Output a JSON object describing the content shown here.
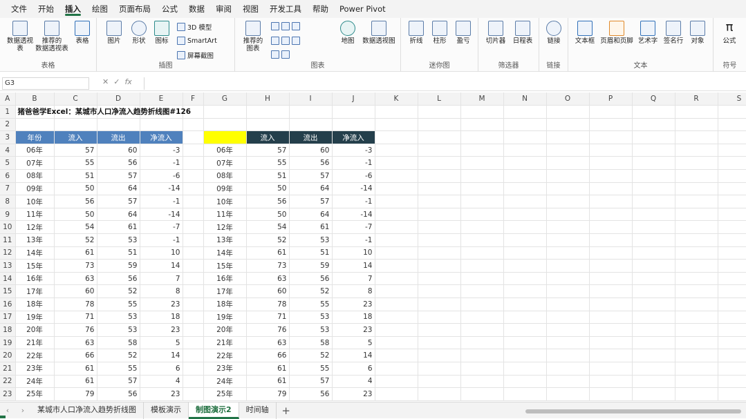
{
  "menu": [
    "文件",
    "开始",
    "插入",
    "绘图",
    "页面布局",
    "公式",
    "数据",
    "审阅",
    "视图",
    "开发工具",
    "帮助",
    "Power Pivot"
  ],
  "menu_active_index": 2,
  "ribbon": {
    "tables": {
      "title": "表格",
      "b1": "数据透视表",
      "b1b": "视表",
      "b2": "推荐的",
      "b2b": "数据透视表",
      "b3": "表格"
    },
    "illus": {
      "title": "插图",
      "b1": "图片",
      "b2": "形状",
      "b3": "图标",
      "s1": "3D 模型",
      "s2": "SmartArt",
      "s3": "屏幕截图"
    },
    "charts": {
      "title": "图表",
      "b1": "推荐的",
      "b1b": "图表",
      "b2": "地图",
      "b3": "数据透视图"
    },
    "spark": {
      "title": "迷你图",
      "b1": "折线",
      "b2": "柱形",
      "b3": "盈亏"
    },
    "filters": {
      "title": "筛选器",
      "b1": "切片器",
      "b2": "日程表"
    },
    "links": {
      "title": "链接",
      "b1": "链接"
    },
    "text": {
      "title": "文本",
      "b1": "文本框",
      "b2": "页眉和页脚",
      "b3": "艺术字",
      "b4": "签名行",
      "b5": "对象"
    },
    "symbols": {
      "title": "符号",
      "b1": "公式"
    }
  },
  "formula_bar": {
    "name_box": "G3",
    "fx": "fx",
    "value": ""
  },
  "columns": [
    "A",
    "B",
    "C",
    "D",
    "E",
    "F",
    "G",
    "H",
    "I",
    "J",
    "K",
    "L",
    "M",
    "N",
    "O",
    "P",
    "Q",
    "R",
    "S"
  ],
  "title": "猪爸爸学Excel：某城市人口净流入趋势折线图#126",
  "headers_left": [
    "年份",
    "流入",
    "流出",
    "净流入"
  ],
  "headers_right": [
    "流入",
    "流出",
    "净流入"
  ],
  "rows": [
    [
      "06年",
      57,
      60,
      -3
    ],
    [
      "07年",
      55,
      56,
      -1
    ],
    [
      "08年",
      51,
      57,
      -6
    ],
    [
      "09年",
      50,
      64,
      -14
    ],
    [
      "10年",
      56,
      57,
      -1
    ],
    [
      "11年",
      50,
      64,
      -14
    ],
    [
      "12年",
      54,
      61,
      -7
    ],
    [
      "13年",
      52,
      53,
      -1
    ],
    [
      "14年",
      61,
      51,
      10
    ],
    [
      "15年",
      73,
      59,
      14
    ],
    [
      "16年",
      63,
      56,
      7
    ],
    [
      "17年",
      60,
      52,
      8
    ],
    [
      "18年",
      78,
      55,
      23
    ],
    [
      "19年",
      71,
      53,
      18
    ],
    [
      "20年",
      76,
      53,
      23
    ],
    [
      "21年",
      63,
      58,
      5
    ],
    [
      "22年",
      66,
      52,
      14
    ],
    [
      "23年",
      61,
      55,
      6
    ],
    [
      "24年",
      61,
      57,
      4
    ],
    [
      "25年",
      79,
      56,
      23
    ]
  ],
  "tabs": [
    "某城市人口净流入趋势折线图",
    "模板演示",
    "制图演示2",
    "时间轴"
  ],
  "active_tab_index": 2,
  "colors": {
    "header_left": "#4f81bd",
    "header_right": "#243f4b",
    "highlight": "#ffff00",
    "accent": "#217346"
  }
}
